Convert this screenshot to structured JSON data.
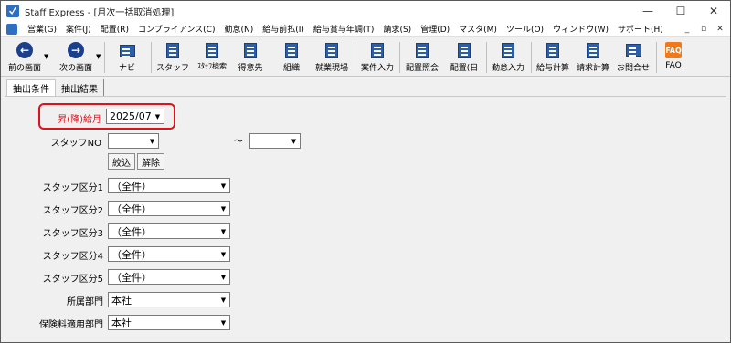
{
  "window": {
    "title": "Staff Express - [月次一括取消処理]",
    "controls": {
      "minimize": "—",
      "maximize": "☐",
      "close": "✕"
    }
  },
  "menu": {
    "items": [
      "営業(G)",
      "案件(J)",
      "配置(R)",
      "コンプライアンス(C)",
      "勤怠(N)",
      "給与前払(I)",
      "給与賞与年調(T)",
      "請求(S)",
      "管理(D)",
      "マスタ(M)",
      "ツール(O)",
      "ウィンドウ(W)",
      "サポート(H)"
    ],
    "mdi_controls": {
      "minimize": "_",
      "restore": "▫",
      "close": "✕"
    }
  },
  "toolbar": {
    "items": [
      {
        "label": "前の画面",
        "icon": "back-arrow-icon"
      },
      {
        "label": "次の画面",
        "icon": "forward-arrow-icon"
      },
      {
        "label": "ナビ",
        "icon": "navi-icon"
      },
      {
        "label": "スタッフ",
        "icon": "staff-icon"
      },
      {
        "label": "ｽﾀｯﾌ検索",
        "icon": "staff-search-icon"
      },
      {
        "label": "得意先",
        "icon": "customer-icon"
      },
      {
        "label": "組織",
        "icon": "organization-icon"
      },
      {
        "label": "就業現場",
        "icon": "worksite-icon"
      },
      {
        "label": "案件入力",
        "icon": "project-entry-icon"
      },
      {
        "label": "配置照会",
        "icon": "assignment-inquiry-icon"
      },
      {
        "label": "配置(日",
        "icon": "assignment-daily-icon"
      },
      {
        "label": "勤怠入力",
        "icon": "attendance-entry-icon"
      },
      {
        "label": "給与計算",
        "icon": "payroll-calc-icon"
      },
      {
        "label": "請求計算",
        "icon": "billing-calc-icon"
      },
      {
        "label": "お問合せ",
        "icon": "inquiry-icon"
      },
      {
        "label": "FAQ",
        "icon": "faq-icon"
      }
    ],
    "faq_icon_text": "FAQ"
  },
  "tabs": [
    "抽出条件",
    "抽出結果"
  ],
  "form": {
    "pay_month": {
      "label": "昇(降)給月",
      "value": "2025/07"
    },
    "staff_no": {
      "label": "スタッフNO",
      "from": "",
      "to": "",
      "range_sep": "～"
    },
    "buttons": {
      "filter": "絞込",
      "clear": "解除"
    },
    "staff_categories": [
      {
        "label": "スタッフ区分1",
        "value": "（全件）"
      },
      {
        "label": "スタッフ区分2",
        "value": "（全件）"
      },
      {
        "label": "スタッフ区分3",
        "value": "（全件）"
      },
      {
        "label": "スタッフ区分4",
        "value": "（全件）"
      },
      {
        "label": "スタッフ区分5",
        "value": "（全件）"
      }
    ],
    "department": {
      "label": "所属部門",
      "value": "本社"
    },
    "insurance_department": {
      "label": "保険料適用部門",
      "value": "本社"
    }
  },
  "colors": {
    "highlight": "#e0111b",
    "toolbar_icon": "#2d5fa8",
    "faq": "#f07a1a"
  }
}
